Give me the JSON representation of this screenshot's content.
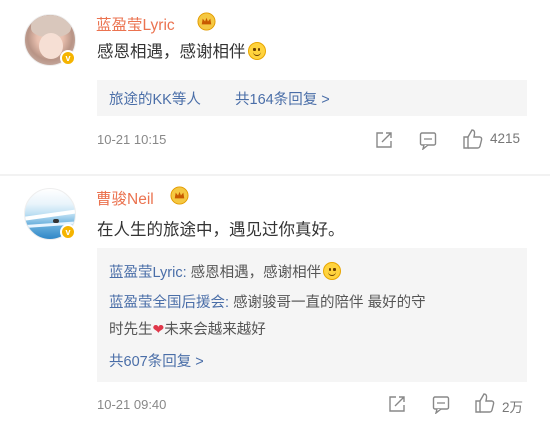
{
  "comments": [
    {
      "username": "蓝盈莹Lyric",
      "content": "感恩相遇，感谢相伴",
      "reply_summary": {
        "names": "旅途的KK等人",
        "count_text": "共164条回复 >"
      },
      "timestamp": "10-21 10:15",
      "likes": "4215"
    },
    {
      "username": "曹骏Neil",
      "content": "在人生的旅途中，遇见过你真好。",
      "replies": [
        {
          "name": "蓝盈莹Lyric:",
          "text": "感恩相遇，感谢相伴"
        },
        {
          "name": "蓝盈莹全国后援会:",
          "text": "感谢骏哥一直的陪伴 最好的守",
          "text2a": "时先生",
          "text2b": "未来会越来越好"
        }
      ],
      "reply_count_text": "共607条回复 >",
      "timestamp": "10-21 09:40",
      "likes": "2万"
    }
  ],
  "icons": {
    "vip_badge": "v-badge-icon",
    "crown": "crown-icon",
    "share": "share-icon",
    "comment": "comment-icon",
    "like": "like-icon",
    "emoji": "smile-emoji",
    "heart": "heart-emoji"
  },
  "colors": {
    "username": "#eb7350",
    "link": "#4a6ea8",
    "reply_bg": "#f5f5f5",
    "badge": "#f5b400"
  }
}
